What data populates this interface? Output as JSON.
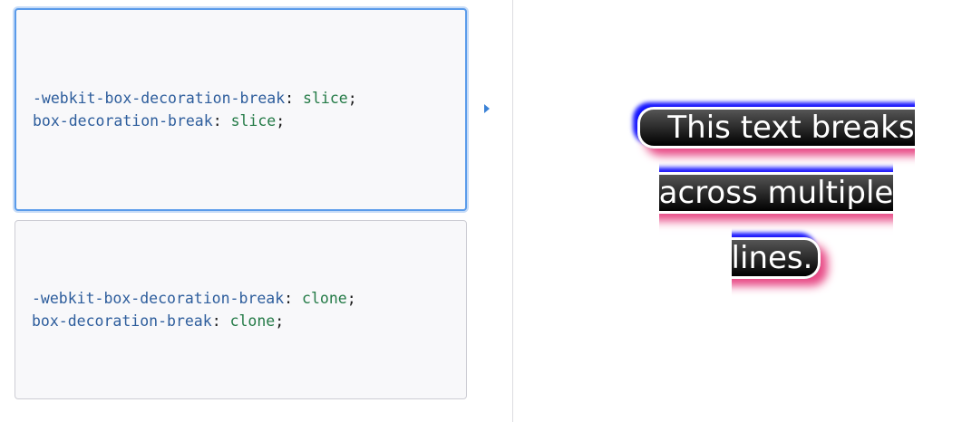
{
  "choices": [
    {
      "selected": true,
      "line1": {
        "prop": "-webkit-box-decoration-break",
        "sep": ": ",
        "value": "slice",
        "end": ";"
      },
      "line2": {
        "prop": "box-decoration-break",
        "sep": ": ",
        "value": "slice",
        "end": ";"
      }
    },
    {
      "selected": false,
      "line1": {
        "prop": "-webkit-box-decoration-break",
        "sep": ": ",
        "value": "clone",
        "end": ";"
      },
      "line2": {
        "prop": "box-decoration-break",
        "sep": ": ",
        "value": "clone",
        "end": ";"
      }
    }
  ],
  "output": {
    "text": "This text breaks across multiple lines."
  },
  "colors": {
    "selected_border": "#5a9bea",
    "property": "#2d5d9c",
    "value": "#237a46",
    "shadow_pink": "#e84a86",
    "shadow_blue": "#1414ff"
  }
}
